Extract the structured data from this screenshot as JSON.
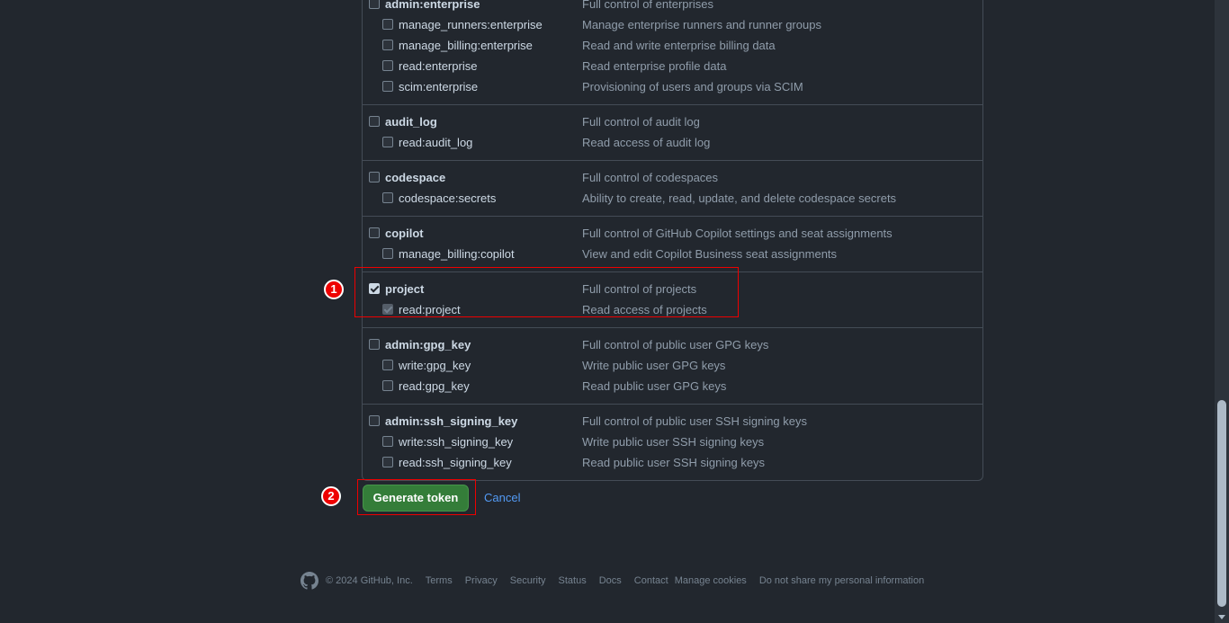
{
  "scopes": [
    {
      "name": "admin:enterprise",
      "desc": "Full control of enterprises",
      "checked": false,
      "children": [
        {
          "name": "manage_runners:enterprise",
          "desc": "Manage enterprise runners and runner groups"
        },
        {
          "name": "manage_billing:enterprise",
          "desc": "Read and write enterprise billing data"
        },
        {
          "name": "read:enterprise",
          "desc": "Read enterprise profile data"
        },
        {
          "name": "scim:enterprise",
          "desc": "Provisioning of users and groups via SCIM"
        }
      ]
    },
    {
      "name": "audit_log",
      "desc": "Full control of audit log",
      "checked": false,
      "children": [
        {
          "name": "read:audit_log",
          "desc": "Read access of audit log"
        }
      ]
    },
    {
      "name": "codespace",
      "desc": "Full control of codespaces",
      "checked": false,
      "children": [
        {
          "name": "codespace:secrets",
          "desc": "Ability to create, read, update, and delete codespace secrets"
        }
      ]
    },
    {
      "name": "copilot",
      "desc": "Full control of GitHub Copilot settings and seat assignments",
      "checked": false,
      "children": [
        {
          "name": "manage_billing:copilot",
          "desc": "View and edit Copilot Business seat assignments"
        }
      ]
    },
    {
      "name": "project",
      "desc": "Full control of projects",
      "checked": true,
      "children": [
        {
          "name": "read:project",
          "desc": "Read access of projects",
          "checked": true,
          "disabled": true
        }
      ]
    },
    {
      "name": "admin:gpg_key",
      "desc": "Full control of public user GPG keys",
      "checked": false,
      "children": [
        {
          "name": "write:gpg_key",
          "desc": "Write public user GPG keys"
        },
        {
          "name": "read:gpg_key",
          "desc": "Read public user GPG keys"
        }
      ]
    },
    {
      "name": "admin:ssh_signing_key",
      "desc": "Full control of public user SSH signing keys",
      "checked": false,
      "children": [
        {
          "name": "write:ssh_signing_key",
          "desc": "Write public user SSH signing keys"
        },
        {
          "name": "read:ssh_signing_key",
          "desc": "Read public user SSH signing keys"
        }
      ]
    }
  ],
  "annotations": {
    "one": "1",
    "two": "2"
  },
  "actions": {
    "generate": "Generate token",
    "cancel": "Cancel"
  },
  "footer": {
    "copyright": "© 2024 GitHub, Inc.",
    "links": [
      "Terms",
      "Privacy",
      "Security",
      "Status",
      "Docs",
      "Contact",
      "Manage cookies",
      "Do not share my personal information"
    ]
  },
  "colors": {
    "accent_green": "#347d39",
    "link": "#539bf5",
    "annotation": "#ee0000"
  }
}
